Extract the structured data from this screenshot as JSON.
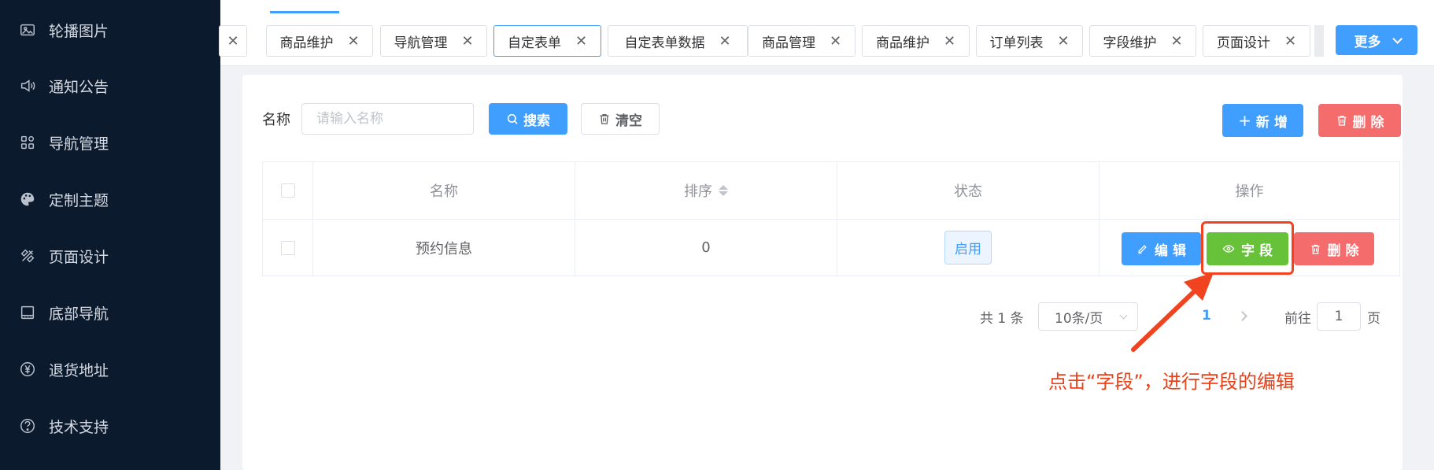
{
  "sidebar": {
    "items": [
      {
        "label": "轮播图片",
        "icon": "image-icon"
      },
      {
        "label": "通知公告",
        "icon": "speaker-icon"
      },
      {
        "label": "导航管理",
        "icon": "grid-icon"
      },
      {
        "label": "定制主题",
        "icon": "palette-icon"
      },
      {
        "label": "页面设计",
        "icon": "tools-icon"
      },
      {
        "label": "底部导航",
        "icon": "bottom-nav-icon"
      },
      {
        "label": "退货地址",
        "icon": "yen-icon"
      },
      {
        "label": "技术支持",
        "icon": "support-icon"
      }
    ]
  },
  "tabs": [
    {
      "label": ""
    },
    {
      "label": "商品维护"
    },
    {
      "label": "导航管理"
    },
    {
      "label": "自定表单",
      "active": true
    },
    {
      "label": "自定表单数据"
    },
    {
      "label": "商品管理"
    },
    {
      "label": "商品维护"
    },
    {
      "label": "订单列表"
    },
    {
      "label": "字段维护"
    },
    {
      "label": "页面设计"
    }
  ],
  "more_button": "更多",
  "search": {
    "label": "名称",
    "placeholder": "请输入名称",
    "search_button": "搜索",
    "clear_button": "清空"
  },
  "actions": {
    "add": "新 增",
    "delete": "删 除"
  },
  "table": {
    "headers": [
      "名称",
      "排序",
      "状态",
      "操作"
    ],
    "rows": [
      {
        "name": "预约信息",
        "sort": "0",
        "status": "启用",
        "edit": "编 辑",
        "field": "字 段",
        "delete": "删 除"
      }
    ]
  },
  "pagination": {
    "total": "共 1 条",
    "page_size": "10条/页",
    "current": "1",
    "goto_label": "前往",
    "goto_value": "1",
    "page_suffix": "页"
  },
  "annotation": "点击“字段”，进行字段的编辑",
  "colors": {
    "primary": "#409eff",
    "success": "#67c23a",
    "danger": "#f56c6c",
    "sidebar_bg": "#0c1a2e",
    "annotation": "#e8421c"
  }
}
